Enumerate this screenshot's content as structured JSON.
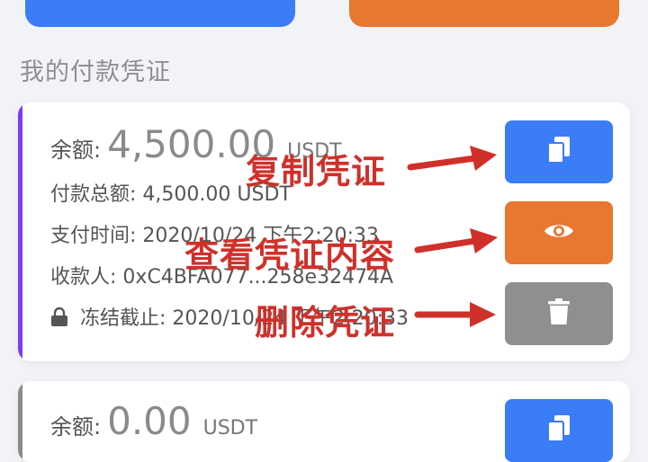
{
  "section_title": "我的付款凭证",
  "vouchers": [
    {
      "balance_label": "余额:",
      "balance_amount": "4,500.00",
      "balance_unit": "USDT",
      "total_label": "付款总额:",
      "total_value": "4,500.00 USDT",
      "time_label": "支付时间:",
      "time_value": "2020/10/24 下午2:20:33",
      "payee_label": "收款人:",
      "payee_value": "0xC4BFA077...258e32474A",
      "freeze_label": "冻结截止:",
      "freeze_value": "2020/10/24 下午2:20:33",
      "accent_color": "#7a3cf0"
    },
    {
      "balance_label": "余额:",
      "balance_amount": "0.00",
      "balance_unit": "USDT",
      "accent_color": "#8a8a8a"
    }
  ],
  "actions": {
    "copy_icon": "copy-icon",
    "view_icon": "eye-icon",
    "delete_icon": "trash-icon",
    "copy_color": "#3b7cf7",
    "view_color": "#e87730",
    "delete_color": "#8f8f8f"
  },
  "annotations": {
    "copy": "复制凭证",
    "view": "查看凭证内容",
    "delete": "删除凭证",
    "color": "#d0302a"
  }
}
